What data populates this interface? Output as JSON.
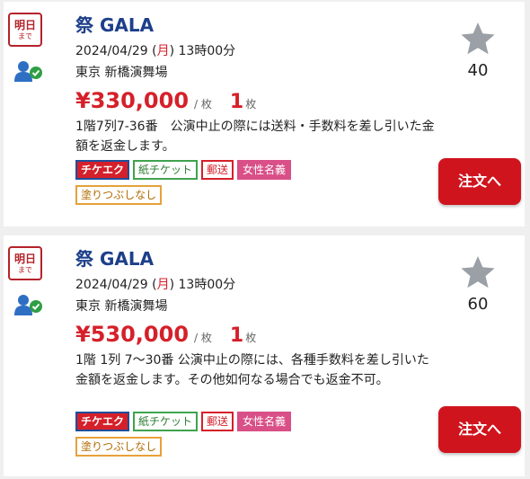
{
  "listings": [
    {
      "deadline_label": "明日",
      "deadline_sub": "まで",
      "title": "祭 GALA",
      "date_prefix": "2024/04/29 (",
      "day_of_week": "月",
      "date_suffix": ") 13時00分",
      "venue": "東京 新橋演舞場",
      "price": "¥330,000",
      "price_unit": "/ 枚",
      "quantity": "1",
      "quantity_unit": "枚",
      "note": "1階7列7-36番　公演中止の際には送料・手数料を差し引いた金額を返金します。",
      "tags": [
        "チケエク",
        "紙チケット",
        "郵送",
        "女性名義",
        "塗りつぶしなし"
      ],
      "favorite_count": "40",
      "order_label": "注文へ"
    },
    {
      "deadline_label": "明日",
      "deadline_sub": "まで",
      "title": "祭 GALA",
      "date_prefix": "2024/04/29 (",
      "day_of_week": "月",
      "date_suffix": ") 13時00分",
      "venue": "東京 新橋演舞場",
      "price": "¥530,000",
      "price_unit": "/ 枚",
      "quantity": "1",
      "quantity_unit": "枚",
      "note": "1階 1列 7～30番 公演中止の際には、各種手数料を差し引いた金額を返金します。その他如何なる場合でも返金不可。",
      "tags": [
        "チケエク",
        "紙チケット",
        "郵送",
        "女性名義",
        "塗りつぶしなし"
      ],
      "favorite_count": "60",
      "order_label": "注文へ"
    }
  ],
  "icons": {
    "verified_user": "verified-user-icon",
    "favorite": "star-icon"
  },
  "colors": {
    "price_red": "#d5202a",
    "title_blue": "#1d3f8a",
    "button_red": "#d0141e",
    "star_gray": "#9aa0a6"
  }
}
